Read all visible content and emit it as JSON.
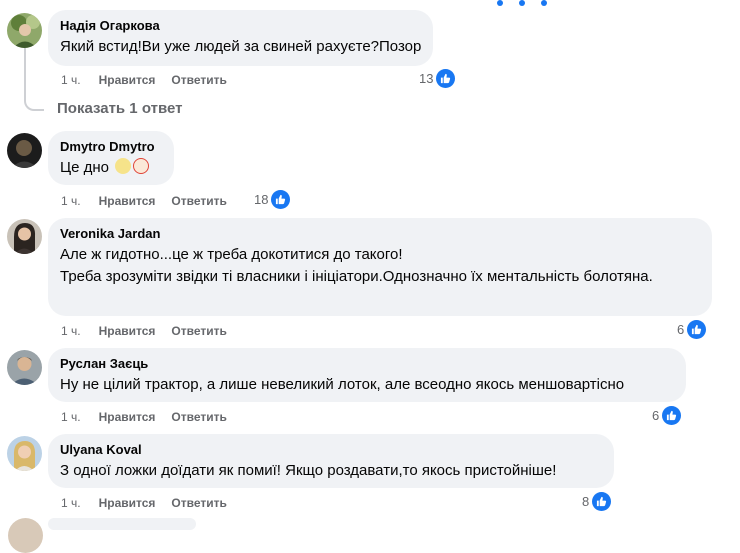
{
  "comments": [
    {
      "author": "Надія Огаркова",
      "text": "Який встид!Ви уже людей за свиней рахуєте?Позор",
      "time": "1 ч.",
      "like_label": "Нравится",
      "reply_label": "Ответить",
      "likes": "13",
      "avatar_icon": "person-with-plants-avatar"
    },
    {
      "author": "Dmytro Dmytro",
      "text": "Це дно",
      "time": "1 ч.",
      "like_label": "Нравится",
      "reply_label": "Ответить",
      "likes": "18",
      "emojis": [
        "eyes-emoji",
        "clown-face-emoji"
      ],
      "avatar_icon": "dark-portrait-avatar"
    },
    {
      "author": "Veronika Jardan",
      "text": "Але ж гидотно...це ж треба докотитися до такого!\nТреба зрозуміти звідки ті власники і ініціатори.Однозначно їх ментальність болотяна.",
      "time": "1 ч.",
      "like_label": "Нравится",
      "reply_label": "Ответить",
      "likes": "6",
      "avatar_icon": "dark-hair-woman-avatar"
    },
    {
      "author": "Руслан Заєць",
      "text": "Ну не цілий трактор, а лише невеликий лоток, але всеодно якось меншовартісно",
      "time": "1 ч.",
      "like_label": "Нравится",
      "reply_label": "Ответить",
      "likes": "6",
      "avatar_icon": "man-portrait-avatar"
    },
    {
      "author": "Ulyana Koval",
      "text": "З одної ложки доїдати як помиї! Якщо роздавати,то якось пристойніше!",
      "time": "1 ч.",
      "like_label": "Нравится",
      "reply_label": "Ответить",
      "likes": "8",
      "avatar_icon": "blonde-woman-avatar"
    }
  ],
  "show_replies_label": "Показать 1 ответ",
  "colors": {
    "bubble": "#f0f2f5",
    "meta_text": "#65676b",
    "like_blue": "#1877f2"
  }
}
